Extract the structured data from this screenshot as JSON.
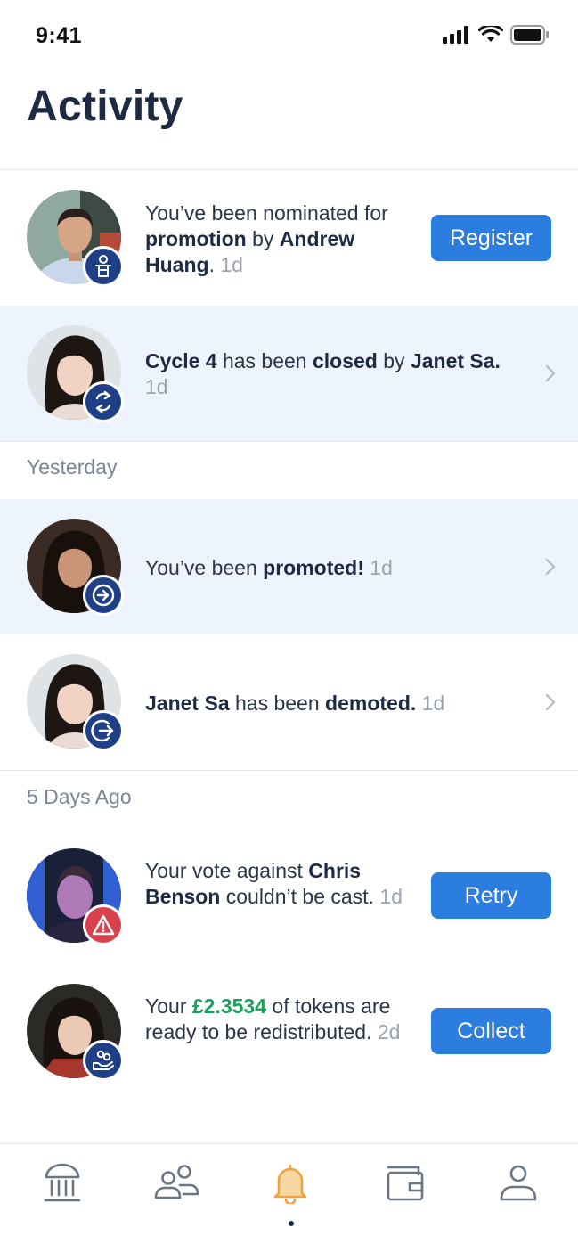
{
  "status_bar": {
    "time": "9:41"
  },
  "page": {
    "title": "Activity"
  },
  "colors": {
    "primary_button": "#2b7de0",
    "highlight_row": "#eef4fd",
    "badge": "#1f3f86",
    "warn_badge": "#d9424c",
    "amount": "#1aa05a",
    "active_tab": "#f2a23a"
  },
  "sections": [
    {
      "label": ""
    },
    {
      "label": "Yesterday"
    },
    {
      "label": "5 Days Ago"
    }
  ],
  "items": [
    {
      "badge_icon": "person-podium-icon",
      "parts": [
        "You’ve been nominated for ",
        "promotion",
        " by ",
        "Andrew Huang",
        "."
      ],
      "time": "1d",
      "button": "Register"
    },
    {
      "badge_icon": "cycle-arrows-icon",
      "parts": [
        "Cycle 4",
        " has been ",
        "closed",
        " by ",
        "Janet Sa",
        "."
      ],
      "time": "1d"
    },
    {
      "badge_icon": "arrow-in-circle-icon",
      "parts": [
        "You’ve been ",
        "promoted!"
      ],
      "time": "1d"
    },
    {
      "badge_icon": "arrow-out-circle-icon",
      "parts": [
        "Janet Sa",
        " has been ",
        "demoted."
      ],
      "time": "1d"
    },
    {
      "badge_icon": "warning-triangle-icon",
      "parts": [
        "Your vote against ",
        "Chris Benson",
        " couldn’t be cast."
      ],
      "time": "1d",
      "button": "Retry"
    },
    {
      "badge_icon": "hand-coins-icon",
      "parts": [
        "Your ",
        "£2.3534",
        " of tokens are ready to be redistributed."
      ],
      "time": "2d",
      "button": "Collect"
    }
  ],
  "tabs": [
    {
      "icon": "bank-icon"
    },
    {
      "icon": "people-icon"
    },
    {
      "icon": "bell-icon",
      "active": true
    },
    {
      "icon": "wallet-icon"
    },
    {
      "icon": "profile-icon"
    }
  ]
}
